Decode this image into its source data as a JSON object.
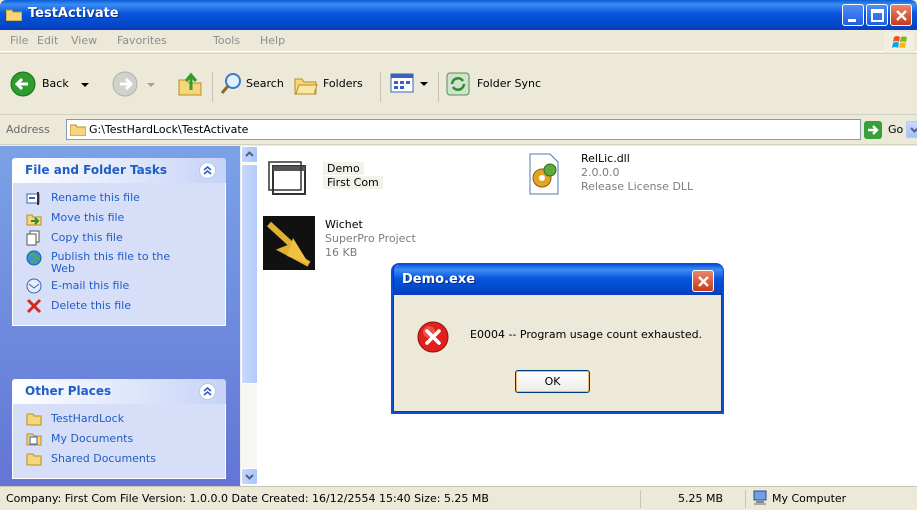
{
  "window": {
    "title": "TestActivate"
  },
  "menu": [
    "File",
    "Edit",
    "View",
    "Favorites",
    "Tools",
    "Help"
  ],
  "toolbar": {
    "back_label": "Back",
    "search_label": "Search",
    "folders_label": "Folders",
    "folder_sync_label": "Folder Sync"
  },
  "address": {
    "label": "Address",
    "path": "G:\\TestHardLock\\TestActivate",
    "go_label": "Go"
  },
  "file_tasks": {
    "title": "File and Folder Tasks",
    "items": [
      {
        "label": "Rename this file",
        "icon": "rename-icon"
      },
      {
        "label": "Move this file",
        "icon": "move-icon"
      },
      {
        "label": "Copy this file",
        "icon": "copy-icon"
      },
      {
        "label": "Publish this file to the Web",
        "icon": "publish-icon"
      },
      {
        "label": "E-mail this file",
        "icon": "email-icon"
      },
      {
        "label": "Delete this file",
        "icon": "delete-icon"
      }
    ]
  },
  "other_places": {
    "title": "Other Places",
    "items": [
      {
        "label": "TestHardLock",
        "icon": "folder-icon"
      },
      {
        "label": "My Documents",
        "icon": "my-documents-icon"
      },
      {
        "label": "Shared Documents",
        "icon": "folder-icon"
      }
    ]
  },
  "files": [
    {
      "name": "Demo",
      "line2": "First Com",
      "line3": ""
    },
    {
      "name": "RelLic.dll",
      "line2": "2.0.0.0",
      "line3": "Release License DLL"
    },
    {
      "name": "Wichet",
      "line2": "SuperPro Project",
      "line3": "16 KB"
    }
  ],
  "status": {
    "details": "Company: First Com File Version: 1.0.0.0 Date Created: 16/12/2554 15:40 Size: 5.25 MB",
    "size": "5.25 MB",
    "location": "My Computer"
  },
  "dialog": {
    "title": "Demo.exe",
    "message": "E0004 -- Program usage count exhausted.",
    "ok_label": "OK"
  },
  "colors": {
    "xp_blue": "#0855dd",
    "task_link": "#215dc6",
    "error_red": "#e0201b"
  }
}
